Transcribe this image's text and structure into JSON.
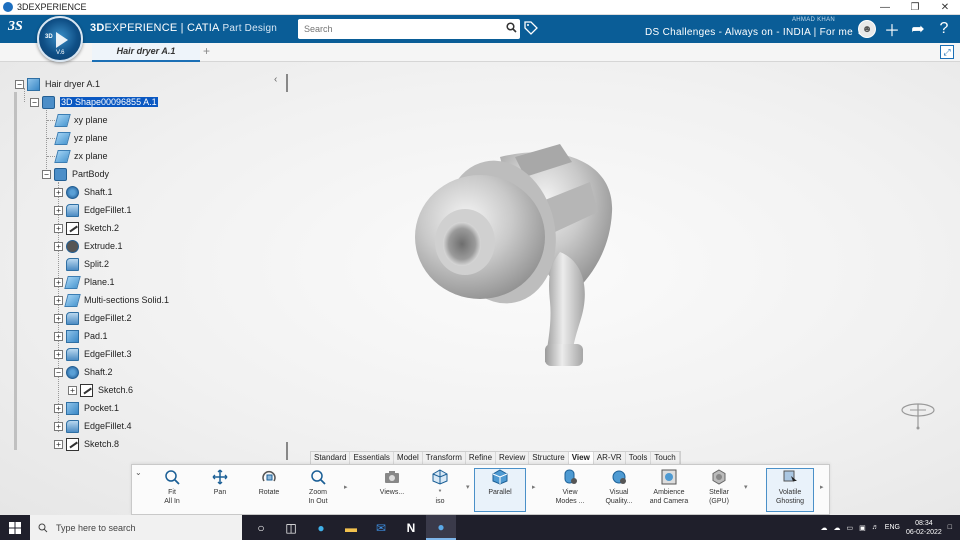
{
  "window": {
    "title": "3DEXPERIENCE",
    "controls": [
      "minimize-icon",
      "restore-icon",
      "close-icon"
    ]
  },
  "header": {
    "brand_prefix": "3D",
    "brand_main": "EXPERIENCE | CATIA",
    "brand_app": "Part Design",
    "compass_label": "3D",
    "compass_version": "V.6",
    "search_placeholder": "Search",
    "user_name": "AHMAD KHAN",
    "collab_space": "DS Challenges - Always on - INDIA | For me",
    "icons": [
      "avatar",
      "add-icon",
      "share-icon",
      "help-icon"
    ]
  },
  "tabs": {
    "document": "Hair dryer A.1",
    "add": "+"
  },
  "tree": {
    "root": "Hair dryer A.1",
    "shape": "3D Shape00096855 A.1",
    "planes": [
      "xy plane",
      "yz plane",
      "zx plane"
    ],
    "body": "PartBody",
    "features": [
      {
        "label": "Shaft.1",
        "icon": "shaft-icon"
      },
      {
        "label": "EdgeFillet.1",
        "icon": "fillet-icon"
      },
      {
        "label": "Sketch.2",
        "icon": "sketch-icon"
      },
      {
        "label": "Extrude.1",
        "icon": "extrude-icon"
      },
      {
        "label": "Split.2",
        "icon": "split-icon"
      },
      {
        "label": "Plane.1",
        "icon": "plane-icon"
      },
      {
        "label": "Multi-sections Solid.1",
        "icon": "multisection-icon"
      },
      {
        "label": "EdgeFillet.2",
        "icon": "fillet-icon"
      },
      {
        "label": "Pad.1",
        "icon": "pad-icon"
      },
      {
        "label": "EdgeFillet.3",
        "icon": "fillet-icon"
      },
      {
        "label": "Shaft.2",
        "icon": "shaft-icon"
      },
      {
        "label": "Sketch.6",
        "icon": "sketch-icon"
      },
      {
        "label": "Pocket.1",
        "icon": "pocket-icon"
      },
      {
        "label": "EdgeFillet.4",
        "icon": "fillet-icon"
      },
      {
        "label": "Sketch.8",
        "icon": "sketch-icon"
      }
    ]
  },
  "section_tabs": [
    "Standard",
    "Essentials",
    "Model",
    "Transform",
    "Refine",
    "Review",
    "Structure",
    "View",
    "AR-VR",
    "Tools",
    "Touch"
  ],
  "active_section": "View",
  "commands": [
    {
      "label": "Fit\nAll In",
      "icon": "fit-all-icon"
    },
    {
      "label": "Pan",
      "icon": "pan-icon"
    },
    {
      "label": "Rotate",
      "icon": "rotate-icon"
    },
    {
      "label": "Zoom\nIn Out",
      "icon": "zoom-icon"
    },
    {
      "label": "Views...",
      "icon": "camera-icon"
    },
    {
      "label": "*\niso",
      "icon": "iso-icon"
    },
    {
      "label": "Parallel",
      "icon": "parallel-icon"
    },
    {
      "label": "View\nModes ...",
      "icon": "view-modes-icon"
    },
    {
      "label": "Visual\nQuality...",
      "icon": "visual-quality-icon"
    },
    {
      "label": "Ambience\nand Camera",
      "icon": "ambience-icon"
    },
    {
      "label": "Stellar\n(GPU)",
      "icon": "stellar-icon"
    },
    {
      "label": "Volatile\nGhosting",
      "icon": "ghosting-icon"
    }
  ],
  "taskbar": {
    "search_placeholder": "Type here to search",
    "language": "ENG",
    "time": "08:34",
    "date": "06-02-2022"
  },
  "colors": {
    "header_blue": "#0a5d97",
    "selection": "#0a58c2"
  }
}
